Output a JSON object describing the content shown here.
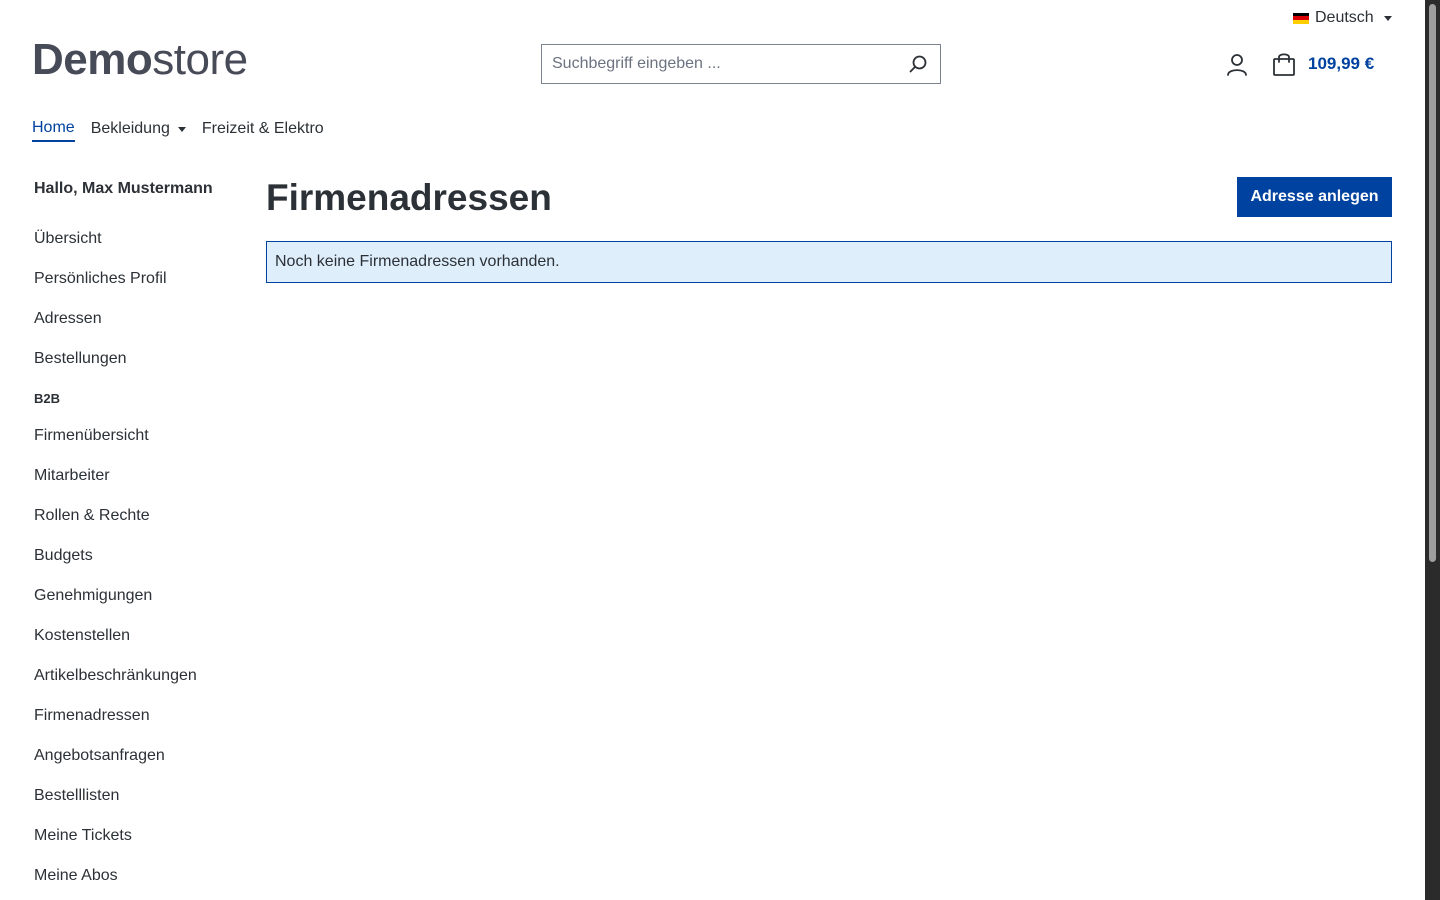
{
  "language": {
    "label": "Deutsch",
    "flag_colors": [
      "#000000",
      "#dd0000",
      "#ffce00"
    ]
  },
  "logo": {
    "bold": "Demo",
    "light": "store"
  },
  "search": {
    "placeholder": "Suchbegriff eingeben ..."
  },
  "cart": {
    "total": "109,99 €"
  },
  "nav": {
    "items": [
      {
        "label": "Home",
        "active": true
      },
      {
        "label": "Bekleidung",
        "dropdown": true
      },
      {
        "label": "Freizeit & Elektro"
      }
    ]
  },
  "sidebar": {
    "greeting": "Hallo, Max Mustermann",
    "items": [
      {
        "label": "Übersicht"
      },
      {
        "label": "Persönliches Profil"
      },
      {
        "label": "Adressen"
      },
      {
        "label": "Bestellungen"
      }
    ],
    "b2b_heading": "B2B",
    "b2b_items": [
      {
        "label": "Firmenübersicht"
      },
      {
        "label": "Mitarbeiter"
      },
      {
        "label": "Rollen & Rechte"
      },
      {
        "label": "Budgets"
      },
      {
        "label": "Genehmigungen"
      },
      {
        "label": "Kostenstellen"
      },
      {
        "label": "Artikelbeschränkungen"
      },
      {
        "label": "Firmenadressen"
      },
      {
        "label": "Angebotsanfragen"
      },
      {
        "label": "Bestelllisten"
      },
      {
        "label": "Meine Tickets"
      },
      {
        "label": "Meine Abos"
      }
    ]
  },
  "main": {
    "title": "Firmenadressen",
    "add_button": "Adresse anlegen",
    "empty_message": "Noch keine Firmenadressen vorhanden."
  },
  "colors": {
    "primary": "#0042a0",
    "alert_bg": "#dfeefb",
    "text": "#2b3136"
  }
}
